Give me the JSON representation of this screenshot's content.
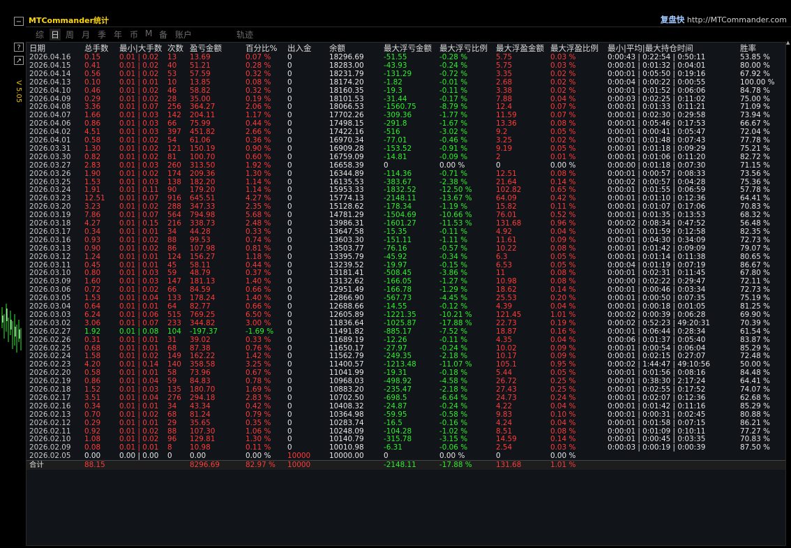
{
  "window": {
    "title": "MTCommander统计",
    "replay_label": "复盘快",
    "site": "http://MTCommander.com"
  },
  "side": {
    "btn1": "−",
    "btn2": "?",
    "btn3": "↗",
    "version": "V 5.05"
  },
  "tabs": [
    {
      "label": "日"
    },
    {
      "label": "周"
    },
    {
      "label": "月"
    },
    {
      "label": "季"
    },
    {
      "label": "年"
    },
    {
      "label": "币"
    },
    {
      "label": "M"
    },
    {
      "label": "备"
    },
    {
      "label": "账户"
    },
    {
      "label": "轨迹"
    }
  ],
  "tab_first_partial": "综",
  "columns": [
    "日期",
    "总手数",
    "最小|大手数",
    "次数",
    "盈亏金额",
    "百分比%",
    "出入金",
    "余额",
    "最大浮亏金额",
    "最大浮亏比例",
    "最大浮盈金额",
    "最大浮盈比例",
    "最小|平均|最大持仓时间",
    "胜率"
  ],
  "rows": [
    [
      "2026.04.16",
      "0.15",
      "0.01 | 0.02",
      "13",
      "13.69",
      "0.07 %",
      "0",
      "18296.69",
      "-51.55",
      "-0.28 %",
      "5.75",
      "0.03 %",
      "0:00:43 | 0:22:54 | 0:50:11",
      "53.85 %"
    ],
    [
      "2026.04.15",
      "0.41",
      "0.01 | 0.02",
      "40",
      "51.21",
      "0.28 %",
      "0",
      "18283.00",
      "-43.93",
      "-0.24 %",
      "5.75",
      "0.03 %",
      "0:00:01 | 0:01:32 | 0:04:01",
      "80.00 %"
    ],
    [
      "2026.04.14",
      "0.56",
      "0.01 | 0.02",
      "53",
      "57.59",
      "0.32 %",
      "0",
      "18231.79",
      "-131.29",
      "-0.72 %",
      "3.35",
      "0.02 %",
      "0:00:01 | 0:05:50 | 0:19:16",
      "67.92 %"
    ],
    [
      "2026.04.13",
      "0.10",
      "0.01 | 0.01",
      "10",
      "13.85",
      "0.08 %",
      "0",
      "18174.20",
      "-1.82",
      "-0.01 %",
      "2.68",
      "0.02 %",
      "0:00:04 | 0:00:22 | 0:00:55",
      "100.00 %"
    ],
    [
      "2026.04.10",
      "0.46",
      "0.01 | 0.02",
      "46",
      "58.82",
      "0.32 %",
      "0",
      "18160.35",
      "-19.3",
      "-0.11 %",
      "3.38",
      "0.02 %",
      "0:00:01 | 0:01:52 | 0:06:06",
      "84.78 %"
    ],
    [
      "2026.04.09",
      "0.29",
      "0.01 | 0.02",
      "28",
      "35.00",
      "0.19 %",
      "0",
      "18101.53",
      "-31.44",
      "-0.17 %",
      "7.88",
      "0.04 %",
      "0:00:03 | 0:02:25 | 0:11:02",
      "75.00 %"
    ],
    [
      "2026.04.08",
      "3.36",
      "0.01 | 0.07",
      "256",
      "364.27",
      "2.06 %",
      "0",
      "18066.53",
      "-1560.75",
      "-8.79 %",
      "12.4",
      "0.07 %",
      "0:00:01 | 0:01:33 | 0:11:21",
      "71.09 %"
    ],
    [
      "2026.04.07",
      "1.66",
      "0.01 | 0.03",
      "142",
      "204.11",
      "1.17 %",
      "0",
      "17702.26",
      "-309.36",
      "-1.77 %",
      "11.59",
      "0.07 %",
      "0:00:01 | 0:02:30 | 0:29:58",
      "73.94 %"
    ],
    [
      "2026.04.06",
      "0.86",
      "0.01 | 0.03",
      "66",
      "75.99",
      "0.44 %",
      "0",
      "17498.15",
      "-291.8",
      "-1.67 %",
      "13.36",
      "0.08 %",
      "0:00:01 | 0:05:46 | 0:17:53",
      "66.67 %"
    ],
    [
      "2026.04.02",
      "4.51",
      "0.01 | 0.03",
      "397",
      "451.82",
      "2.66 %",
      "0",
      "17422.16",
      "-516",
      "-3.02 %",
      "9.2",
      "0.05 %",
      "0:00:01 | 0:00:41 | 0:05:47",
      "72.04 %"
    ],
    [
      "2026.04.01",
      "0.58",
      "0.01 | 0.02",
      "54",
      "61.06",
      "0.36 %",
      "0",
      "16970.34",
      "-77.01",
      "-0.46 %",
      "3.25",
      "0.02 %",
      "0:00:01 | 0:01:48 | 0:07:43",
      "77.78 %"
    ],
    [
      "2026.03.31",
      "1.30",
      "0.01 | 0.02",
      "121",
      "150.19",
      "0.90 %",
      "0",
      "16909.28",
      "-153.52",
      "-0.91 %",
      "9.19",
      "0.05 %",
      "0:00:01 | 0:01:18 | 0:09:29",
      "75.21 %"
    ],
    [
      "2026.03.30",
      "0.82",
      "0.01 | 0.02",
      "81",
      "100.70",
      "0.60 %",
      "0",
      "16759.09",
      "-14.81",
      "-0.09 %",
      "2",
      "0.01 %",
      "0:00:01 | 0:01:06 | 0:11:20",
      "82.72 %"
    ],
    [
      "2026.03.27",
      "2.83",
      "0.01 | 0.03",
      "260",
      "313.50",
      "1.92 %",
      "0",
      "16658.39",
      "0",
      "0.00 %",
      "0",
      "0.00 %",
      "0:00:00 | 0:01:18 | 0:07:30",
      "71.15 %"
    ],
    [
      "2026.03.26",
      "1.90",
      "0.01 | 0.02",
      "174",
      "209.36",
      "1.30 %",
      "0",
      "16344.89",
      "-114.36",
      "-0.71 %",
      "12.51",
      "0.08 %",
      "0:00:01 | 0:00:57 | 0:08:33",
      "73.56 %"
    ],
    [
      "2026.03.25",
      "1.53",
      "0.01 | 0.03",
      "138",
      "182.20",
      "1.14 %",
      "0",
      "16135.53",
      "-383.67",
      "-2.38 %",
      "21.64",
      "0.14 %",
      "0:00:02 | 0:00:57 | 0:04:28",
      "75.36 %"
    ],
    [
      "2026.03.24",
      "1.91",
      "0.01 | 0.11",
      "90",
      "179.20",
      "1.14 %",
      "0",
      "15953.33",
      "-1832.52",
      "-12.50 %",
      "102.82",
      "0.65 %",
      "0:00:01 | 0:01:55 | 0:06:59",
      "57.78 %"
    ],
    [
      "2026.03.23",
      "12.51",
      "0.01 | 0.07",
      "916",
      "645.51",
      "4.27 %",
      "0",
      "15774.13",
      "-2148.11",
      "-13.67 %",
      "64.09",
      "0.42 %",
      "0:00:01 | 0:01:10 | 0:12:36",
      "64.41 %"
    ],
    [
      "2026.03.20",
      "3.23",
      "0.01 | 0.02",
      "288",
      "347.33",
      "2.35 %",
      "0",
      "15128.62",
      "-178.34",
      "-1.19 %",
      "15.82",
      "0.11 %",
      "0:00:01 | 0:01:07 | 0:17:06",
      "70.83 %"
    ],
    [
      "2026.03.19",
      "7.86",
      "0.01 | 0.07",
      "564",
      "794.98",
      "5.68 %",
      "0",
      "14781.29",
      "-1504.69",
      "-10.66 %",
      "76.01",
      "0.52 %",
      "0:00:01 | 0:01:35 | 0:13:53",
      "68.32 %"
    ],
    [
      "2026.03.18",
      "4.27",
      "0.01 | 0.15",
      "216",
      "338.73",
      "2.48 %",
      "0",
      "13986.31",
      "-1601.27",
      "-11.53 %",
      "131.68",
      "0.96 %",
      "0:00:02 | 0:08:34 | 0:47:52",
      "56.48 %"
    ],
    [
      "2026.03.17",
      "0.34",
      "0.01 | 0.01",
      "34",
      "44.28",
      "0.33 %",
      "0",
      "13647.58",
      "-15.35",
      "-0.11 %",
      "4.92",
      "0.04 %",
      "0:00:01 | 0:01:59 | 0:12:58",
      "82.35 %"
    ],
    [
      "2026.03.16",
      "0.93",
      "0.01 | 0.02",
      "88",
      "99.53",
      "0.74 %",
      "0",
      "13603.30",
      "-151.11",
      "-1.11 %",
      "11.61",
      "0.09 %",
      "0:00:01 | 0:04:30 | 0:34:09",
      "72.73 %"
    ],
    [
      "2026.03.13",
      "0.90",
      "0.01 | 0.02",
      "86",
      "107.98",
      "0.81 %",
      "0",
      "13503.77",
      "-76.16",
      "-0.57 %",
      "10.22",
      "0.08 %",
      "0:00:01 | 0:01:42 | 0:09:09",
      "79.07 %"
    ],
    [
      "2026.03.12",
      "1.24",
      "0.01 | 0.01",
      "124",
      "156.27",
      "1.18 %",
      "0",
      "13395.79",
      "-45.92",
      "-0.34 %",
      "6.3",
      "0.05 %",
      "0:00:01 | 0:01:14 | 0:11:38",
      "80.65 %"
    ],
    [
      "2026.03.11",
      "0.45",
      "0.01 | 0.01",
      "45",
      "58.11",
      "0.44 %",
      "0",
      "13239.52",
      "-19.97",
      "-0.15 %",
      "6.53",
      "0.05 %",
      "0:00:04 | 0:01:19 | 0:07:19",
      "86.67 %"
    ],
    [
      "2026.03.10",
      "0.80",
      "0.01 | 0.03",
      "59",
      "48.79",
      "0.37 %",
      "0",
      "13181.41",
      "-508.45",
      "-3.86 %",
      "11",
      "0.08 %",
      "0:00:01 | 0:02:31 | 0:11:45",
      "67.80 %"
    ],
    [
      "2026.03.09",
      "1.60",
      "0.01 | 0.03",
      "147",
      "181.13",
      "1.40 %",
      "0",
      "13132.62",
      "-166.05",
      "-1.27 %",
      "10.98",
      "0.08 %",
      "0:00:00 | 0:02:22 | 0:29:47",
      "72.11 %"
    ],
    [
      "2026.03.06",
      "0.72",
      "0.01 | 0.02",
      "66",
      "84.59",
      "0.66 %",
      "0",
      "12951.49",
      "-166.78",
      "-1.29 %",
      "18.62",
      "0.14 %",
      "0:00:01 | 0:00:46 | 0:03:34",
      "72.73 %"
    ],
    [
      "2026.03.05",
      "1.53",
      "0.01 | 0.04",
      "133",
      "178.24",
      "1.40 %",
      "0",
      "12866.90",
      "-567.73",
      "-4.45 %",
      "25.53",
      "0.20 %",
      "0:00:01 | 0:00:50 | 0:07:35",
      "75.19 %"
    ],
    [
      "2026.03.04",
      "0.64",
      "0.01 | 0.01",
      "64",
      "82.77",
      "0.66 %",
      "0",
      "12688.66",
      "-14.55",
      "-0.12 %",
      "4.39",
      "0.04 %",
      "0:00:01 | 0:00:18 | 0:01:05",
      "81.25 %"
    ],
    [
      "2026.03.03",
      "6.24",
      "0.01 | 0.06",
      "515",
      "769.25",
      "6.50 %",
      "0",
      "12605.89",
      "-1221.35",
      "-10.21 %",
      "121.45",
      "1.01 %",
      "0:00:02 | 0:00:39 | 0:06:28",
      "69.90 %"
    ],
    [
      "2026.03.02",
      "3.06",
      "0.01 | 0.07",
      "233",
      "344.82",
      "3.00 %",
      "0",
      "11836.64",
      "-1025.87",
      "-17.88 %",
      "22.73",
      "0.19 %",
      "0:00:02 | 0:52:23 | 49:20:31",
      "70.39 %"
    ],
    [
      "2026.02.27",
      "1.92",
      "0.01 | 0.08",
      "104",
      "-197.37",
      "-1.69 %",
      "0",
      "11491.82",
      "-885.17",
      "-7.52 %",
      "18.87",
      "0.16 %",
      "0:00:01 | 0:06:44 | 0:28:34",
      "61.54 %"
    ],
    [
      "2026.02.26",
      "0.31",
      "0.01 | 0.01",
      "31",
      "39.02",
      "0.33 %",
      "0",
      "11689.19",
      "-12.26",
      "-0.11 %",
      "4.35",
      "0.04 %",
      "0:00:06 | 0:01:37 | 0:05:40",
      "83.87 %"
    ],
    [
      "2026.02.25",
      "0.68",
      "0.01 | 0.01",
      "68",
      "87.38",
      "0.76 %",
      "0",
      "11650.17",
      "-27.97",
      "-0.24 %",
      "10.02",
      "0.09 %",
      "0:00:01 | 0:00:54 | 0:06:04",
      "85.29 %"
    ],
    [
      "2026.02.24",
      "1.58",
      "0.01 | 0.02",
      "149",
      "162.22",
      "1.42 %",
      "0",
      "11562.79",
      "-249.35",
      "-2.18 %",
      "10.17",
      "0.09 %",
      "0:00:01 | 0:02:15 | 0:27:07",
      "72.48 %"
    ],
    [
      "2026.02.23",
      "4.20",
      "0.01 | 0.14",
      "140",
      "358.58",
      "3.25 %",
      "0",
      "11400.57",
      "-1213.48",
      "-11.07 %",
      "105.1",
      "0.95 %",
      "0:00:02 | 1:44:47 | 49:10:56",
      "50.00 %"
    ],
    [
      "2026.02.20",
      "0.58",
      "0.01 | 0.01",
      "58",
      "73.96",
      "0.67 %",
      "0",
      "11041.99",
      "-19.31",
      "-0.18 %",
      "5.44",
      "0.05 %",
      "0:00:01 | 0:01:56 | 0:08:16",
      "84.48 %"
    ],
    [
      "2026.02.19",
      "0.86",
      "0.01 | 0.04",
      "59",
      "84.83",
      "0.78 %",
      "0",
      "10968.03",
      "-498.92",
      "-4.58 %",
      "26.72",
      "0.25 %",
      "0:00:01 | 0:38:30 | 2:17:24",
      "64.41 %"
    ],
    [
      "2026.02.18",
      "1.52",
      "0.01 | 0.03",
      "135",
      "180.70",
      "1.69 %",
      "0",
      "10883.20",
      "-235.47",
      "-2.18 %",
      "27.43",
      "0.25 %",
      "0:00:01 | 0:02:55 | 0:17:52",
      "74.07 %"
    ],
    [
      "2026.02.17",
      "3.51",
      "0.01 | 0.04",
      "276",
      "294.18",
      "2.83 %",
      "0",
      "10702.50",
      "-698.5",
      "-6.64 %",
      "24.73",
      "0.24 %",
      "0:00:01 | 0:02:07 | 0:12:36",
      "62.68 %"
    ],
    [
      "2026.02.16",
      "0.34",
      "0.01 | 0.01",
      "34",
      "43.34",
      "0.42 %",
      "0",
      "10408.32",
      "-24.87",
      "-0.24 %",
      "4.22",
      "0.04 %",
      "0:00:01 | 0:01:42 | 0:11:16",
      "85.29 %"
    ],
    [
      "2026.02.13",
      "0.70",
      "0.01 | 0.02",
      "68",
      "81.24",
      "0.79 %",
      "0",
      "10364.98",
      "-59.95",
      "-0.58 %",
      "9.83",
      "0.10 %",
      "0:00:01 | 0:00:31 | 0:02:45",
      "80.88 %"
    ],
    [
      "2026.02.12",
      "0.29",
      "0.01 | 0.01",
      "29",
      "35.65",
      "0.35 %",
      "0",
      "10283.74",
      "-16.5",
      "-0.16 %",
      "4.24",
      "0.04 %",
      "0:00:01 | 0:01:58 | 0:07:15",
      "86.21 %"
    ],
    [
      "2026.02.11",
      "0.92",
      "0.01 | 0.02",
      "88",
      "107.30",
      "1.06 %",
      "0",
      "10248.09",
      "-104.28",
      "-1.02 %",
      "8.51",
      "0.08 %",
      "0:00:01 | 0:01:09 | 0:10:11",
      "77.27 %"
    ],
    [
      "2026.02.10",
      "1.08",
      "0.01 | 0.02",
      "96",
      "129.81",
      "1.30 %",
      "0",
      "10140.79",
      "-315.78",
      "-3.15 %",
      "14.59",
      "0.14 %",
      "0:00:01 | 0:00:45 | 0:03:35",
      "70.83 %"
    ],
    [
      "2026.02.09",
      "0.08",
      "0.01 | 0.01",
      "8",
      "10.98",
      "0.11 %",
      "0",
      "10010.98",
      "-6.31",
      "-0.06 %",
      "2.54",
      "0.03 %",
      "0:00:03 | 0:00:19 | 0:00:39",
      "87.50 %"
    ],
    [
      "2026.02.05",
      "0.00",
      "0.00 | 0.00",
      "0",
      "0.00",
      "0.00 %",
      "10000",
      "10000.00",
      "0",
      "0.00 %",
      "0",
      "0.00 %",
      "",
      ""
    ]
  ],
  "total": [
    "合计",
    "88.15",
    "",
    "",
    "8296.69",
    "82.97 %",
    "10000",
    "",
    "-2148.11",
    "-17.88 %",
    "131.68",
    "1.01 %",
    "",
    ""
  ],
  "colors": {
    "profit": "#ff3b3b",
    "loss": "#2cf02c",
    "neutral": "#e6e6e6",
    "title": "#ffd800"
  }
}
